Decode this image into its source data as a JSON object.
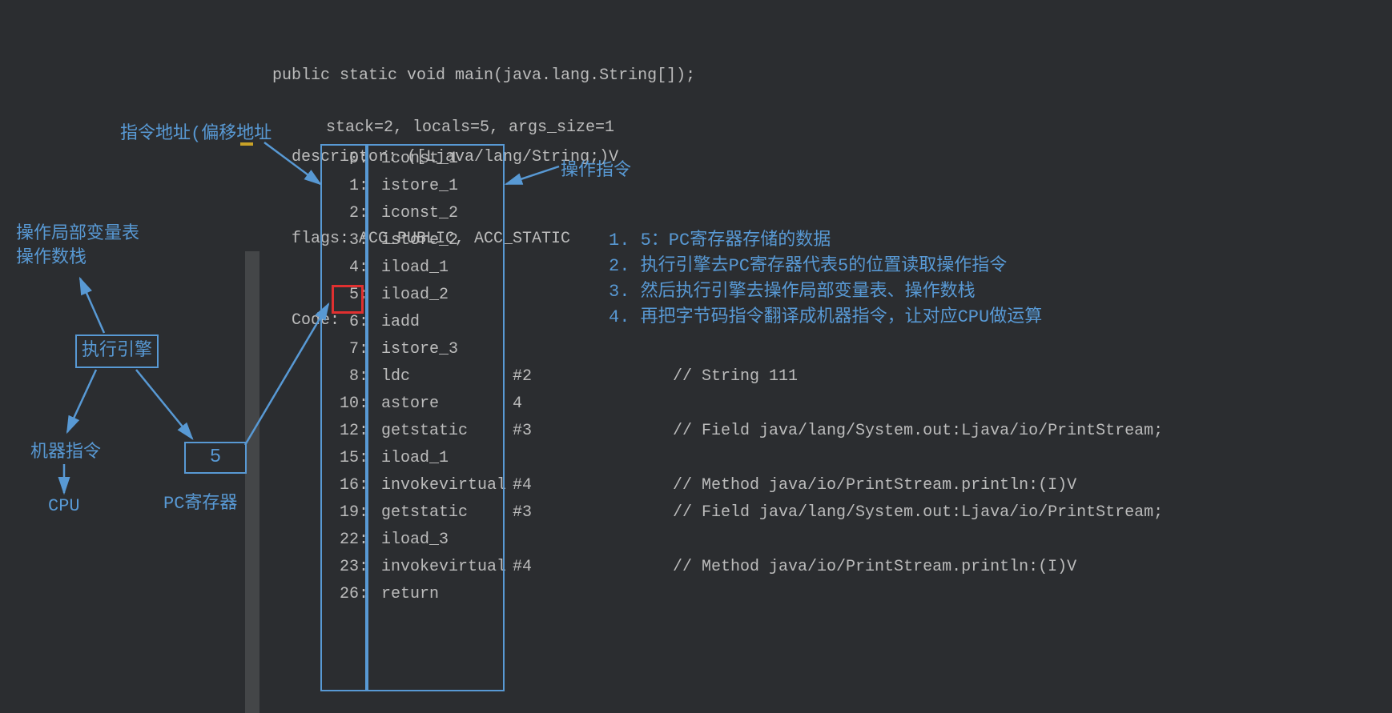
{
  "header": {
    "signature": "public static void main(java.lang.String[]);",
    "descriptor": "  descriptor: ([Ljava/lang/String;)V",
    "flags": "  flags: ACC_PUBLIC, ACC_STATIC",
    "code": "  Code:",
    "stack": "stack=2, locals=5, args_size=1"
  },
  "labels": {
    "addr": "指令地址(偏移地址",
    "op": "操作指令",
    "lvt1": "操作局部变量表",
    "lvt2": "操作数栈",
    "exec": "执行引擎",
    "machine": "机器指令",
    "cpu": "CPU",
    "pc_val": "5",
    "pc": "PC寄存器"
  },
  "notes": {
    "n1": "1. 5：PC寄存器存储的数据",
    "n2": "2. 执行引擎去PC寄存器代表5的位置读取操作指令",
    "n3": "3. 然后执行引擎去操作局部变量表、操作数栈",
    "n4": "4. 再把字节码指令翻译成机器指令，让对应CPU做运算"
  },
  "instructions": [
    {
      "addr": "0",
      "op": "iconst_1",
      "arg": "",
      "comment": ""
    },
    {
      "addr": "1",
      "op": "istore_1",
      "arg": "",
      "comment": ""
    },
    {
      "addr": "2",
      "op": "iconst_2",
      "arg": "",
      "comment": ""
    },
    {
      "addr": "3",
      "op": "istore_2",
      "arg": "",
      "comment": ""
    },
    {
      "addr": "4",
      "op": "iload_1",
      "arg": "",
      "comment": ""
    },
    {
      "addr": "5",
      "op": "iload_2",
      "arg": "",
      "comment": ""
    },
    {
      "addr": "6",
      "op": "iadd",
      "arg": "",
      "comment": ""
    },
    {
      "addr": "7",
      "op": "istore_3",
      "arg": "",
      "comment": ""
    },
    {
      "addr": "8",
      "op": "ldc",
      "arg": "#2",
      "comment": "// String 111"
    },
    {
      "addr": "10",
      "op": "astore",
      "arg": "4",
      "comment": ""
    },
    {
      "addr": "12",
      "op": "getstatic",
      "arg": "#3",
      "comment": "// Field java/lang/System.out:Ljava/io/PrintStream;"
    },
    {
      "addr": "15",
      "op": "iload_1",
      "arg": "",
      "comment": ""
    },
    {
      "addr": "16",
      "op": "invokevirtual",
      "arg": "#4",
      "comment": "// Method java/io/PrintStream.println:(I)V"
    },
    {
      "addr": "19",
      "op": "getstatic",
      "arg": "#3",
      "comment": "// Field java/lang/System.out:Ljava/io/PrintStream;"
    },
    {
      "addr": "22",
      "op": "iload_3",
      "arg": "",
      "comment": ""
    },
    {
      "addr": "23",
      "op": "invokevirtual",
      "arg": "#4",
      "comment": "// Method java/io/PrintStream.println:(I)V"
    },
    {
      "addr": "26",
      "op": "return",
      "arg": "",
      "comment": ""
    }
  ]
}
